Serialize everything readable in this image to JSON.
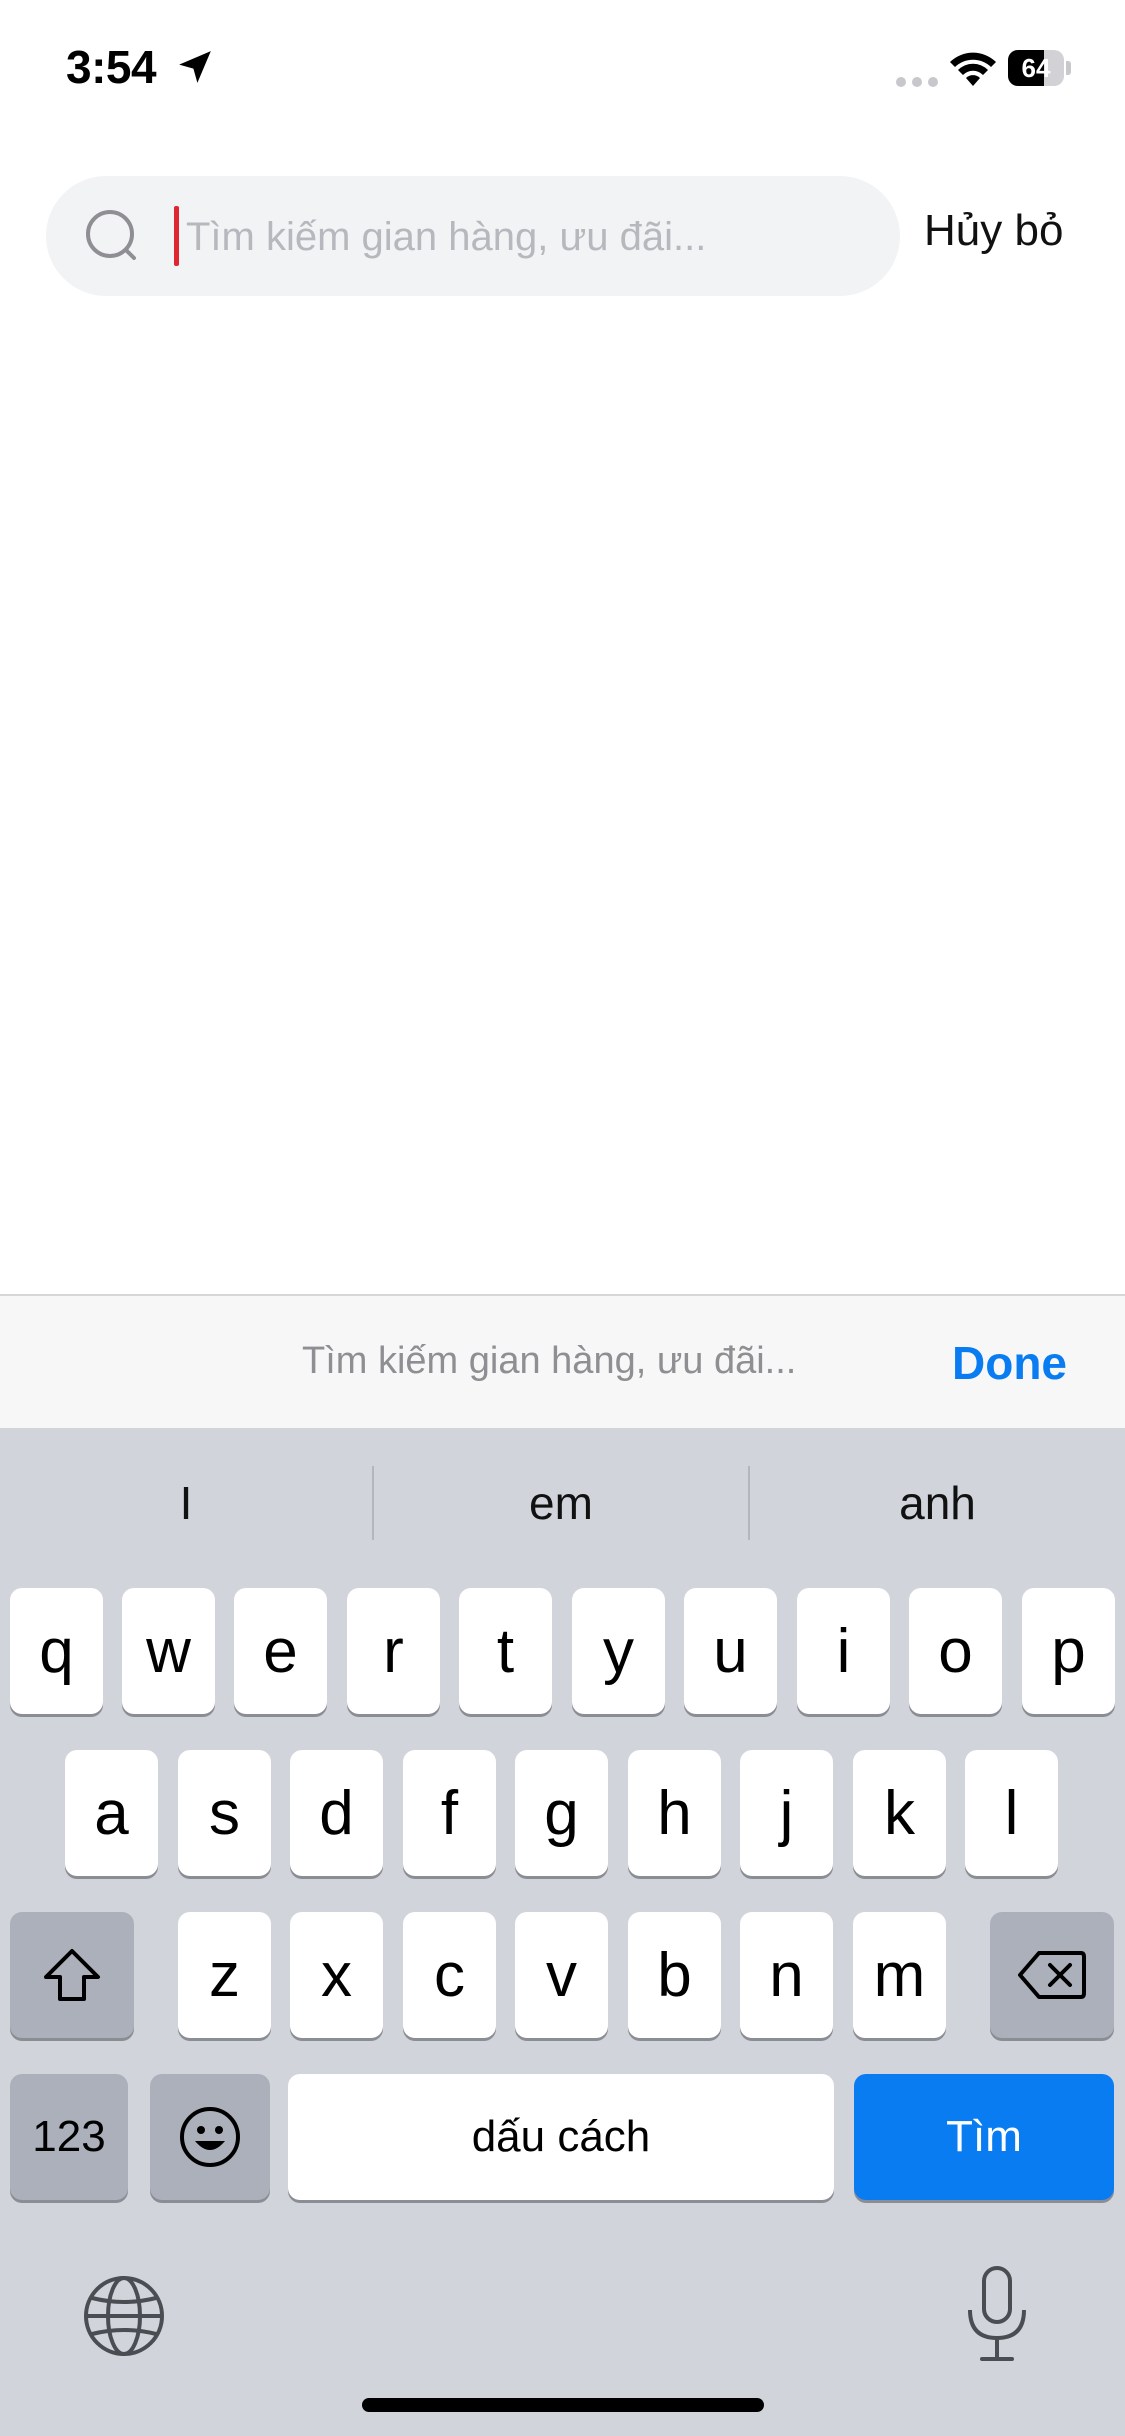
{
  "status_bar": {
    "time": "3:54",
    "battery": "64",
    "battery_level": 0.64,
    "icons": [
      "location-arrow-icon",
      "cellular-dots-icon",
      "wifi-icon",
      "battery-icon"
    ]
  },
  "search": {
    "placeholder": "Tìm kiếm gian hàng, ưu đãi...",
    "value": "",
    "cancel_label": "Hủy bỏ",
    "caret_color": "#e0262f"
  },
  "accessory": {
    "hint": "Tìm kiếm gian hàng, ưu đãi...",
    "done_label": "Done"
  },
  "keyboard": {
    "suggestions": [
      "I",
      "em",
      "anh"
    ],
    "row1": [
      "q",
      "w",
      "e",
      "r",
      "t",
      "y",
      "u",
      "i",
      "o",
      "p"
    ],
    "row2": [
      "a",
      "s",
      "d",
      "f",
      "g",
      "h",
      "j",
      "k",
      "l"
    ],
    "row3": [
      "z",
      "x",
      "c",
      "v",
      "b",
      "n",
      "m"
    ],
    "numbers_label": "123",
    "space_label": "dấu cách",
    "return_label": "Tìm",
    "accent_color": "#0a7cf2"
  }
}
